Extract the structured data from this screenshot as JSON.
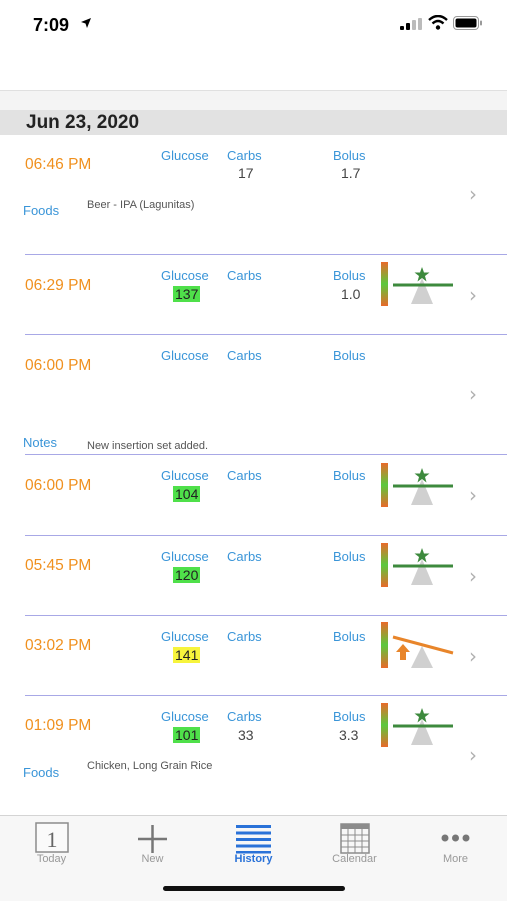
{
  "status": {
    "time": "7:09"
  },
  "date_header": "Jun 23, 2020",
  "labels": {
    "glucose": "Glucose",
    "carbs": "Carbs",
    "bolus": "Bolus"
  },
  "entries": [
    {
      "time": "06:46 PM",
      "carbs": "17",
      "bolus": "1.7",
      "note_label": "Foods",
      "note_text": "Beer - IPA (Lagunitas)"
    },
    {
      "time": "06:29 PM",
      "glucose": "137",
      "glucose_color": "#4fe04a",
      "bolus": "1.0",
      "status": "balanced"
    },
    {
      "time": "06:00 PM",
      "note_label": "Notes",
      "note_text": "New insertion set added."
    },
    {
      "time": "06:00 PM",
      "glucose": "104",
      "glucose_color": "#4fe04a",
      "status": "balanced"
    },
    {
      "time": "05:45 PM",
      "glucose": "120",
      "glucose_color": "#4fe04a",
      "status": "balanced"
    },
    {
      "time": "03:02 PM",
      "glucose": "141",
      "glucose_color": "#f7f43c",
      "status": "high"
    },
    {
      "time": "01:09 PM",
      "glucose": "101",
      "glucose_color": "#4fe04a",
      "carbs": "33",
      "bolus": "3.3",
      "status": "balanced",
      "note_label": "Foods",
      "note_text": "Chicken, Long Grain Rice"
    }
  ],
  "tabs": [
    {
      "label": "Today",
      "icon": "calendar-day-icon",
      "day": "1"
    },
    {
      "label": "New",
      "icon": "plus-icon"
    },
    {
      "label": "History",
      "icon": "list-icon",
      "active": true
    },
    {
      "label": "Calendar",
      "icon": "calendar-grid-icon"
    },
    {
      "label": "More",
      "icon": "more-dots-icon"
    }
  ],
  "colors": {
    "time": "#f0901e",
    "label": "#3a95d8",
    "active_tab": "#2a72d8",
    "separator": "#a8a8e6"
  }
}
